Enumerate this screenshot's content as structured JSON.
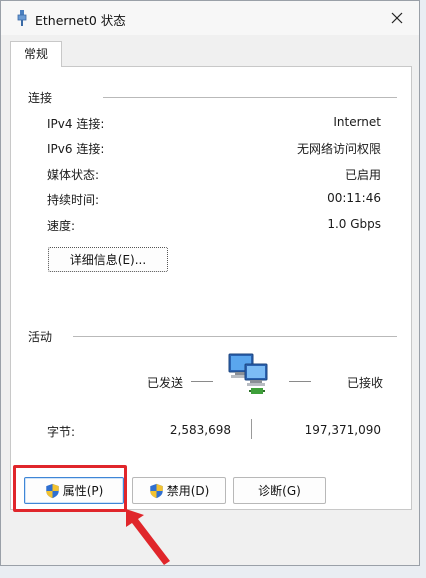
{
  "window": {
    "title": "Ethernet0 状态"
  },
  "tabs": [
    {
      "label": "常规"
    }
  ],
  "connection": {
    "group_label": "连接",
    "rows": [
      {
        "label": "IPv4 连接:",
        "value": "Internet"
      },
      {
        "label": "IPv6 连接:",
        "value": "无网络访问权限"
      },
      {
        "label": "媒体状态:",
        "value": "已启用"
      },
      {
        "label": "持续时间:",
        "value": "00:11:46"
      },
      {
        "label": "速度:",
        "value": "1.0 Gbps"
      }
    ],
    "details_button": "详细信息(E)..."
  },
  "activity": {
    "group_label": "活动",
    "sent_label": "已发送",
    "received_label": "已接收",
    "bytes_label": "字节:",
    "bytes_sent": "2,583,698",
    "bytes_received": "197,371,090"
  },
  "buttons": {
    "properties": "属性(P)",
    "disable": "禁用(D)",
    "diagnose": "诊断(G)"
  },
  "icons": {
    "title": "ethernet-icon",
    "close": "close-icon",
    "network": "network-computers-icon",
    "shield": "uac-shield-icon"
  },
  "colors": {
    "annotation": "#e0262b",
    "focus_border": "#3f86d6"
  }
}
